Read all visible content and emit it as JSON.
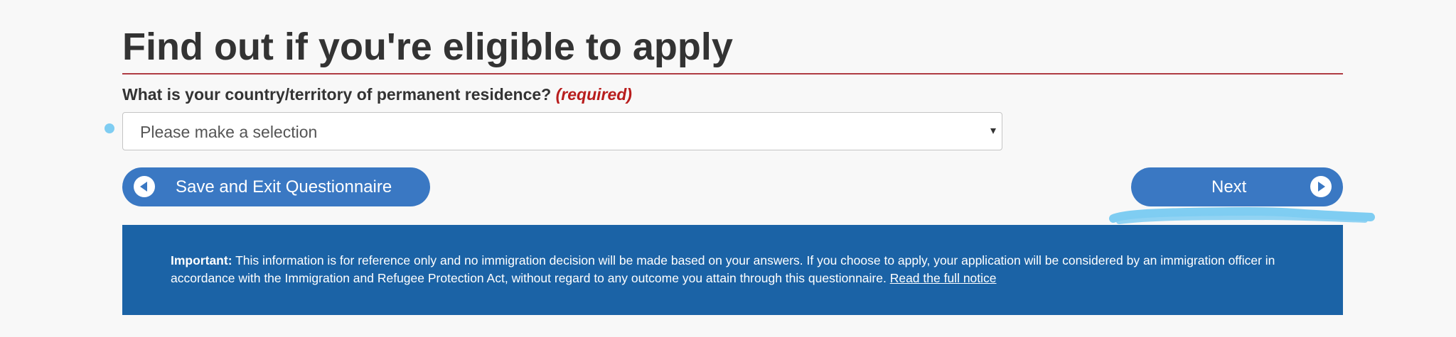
{
  "page": {
    "title": "Find out if you're eligible to apply"
  },
  "question": {
    "label": "What is your country/territory of permanent residence?",
    "required": "(required)",
    "select_value": "Please make a selection",
    "arrow": "▾"
  },
  "buttons": {
    "save_exit": "Save and Exit Questionnaire",
    "next": "Next"
  },
  "notice": {
    "lead": "Important:",
    "body": " This information is for reference only and no immigration decision will be made based on your answers. If you choose to apply, your application will be considered by an immigration officer in accordance with the Immigration and Refugee Protection Act, without regard to any outcome you attain through this questionnaire. ",
    "link": "Read the full notice"
  },
  "icons": {
    "save_exit": "circle-arrow-left-icon",
    "next": "circle-arrow-right-icon"
  },
  "colors": {
    "button": "#3a78c3",
    "notice_bg": "#1b63a6",
    "title_rule": "#af3c43",
    "required": "#b81d1d",
    "annotation": "#7fcdf2"
  }
}
